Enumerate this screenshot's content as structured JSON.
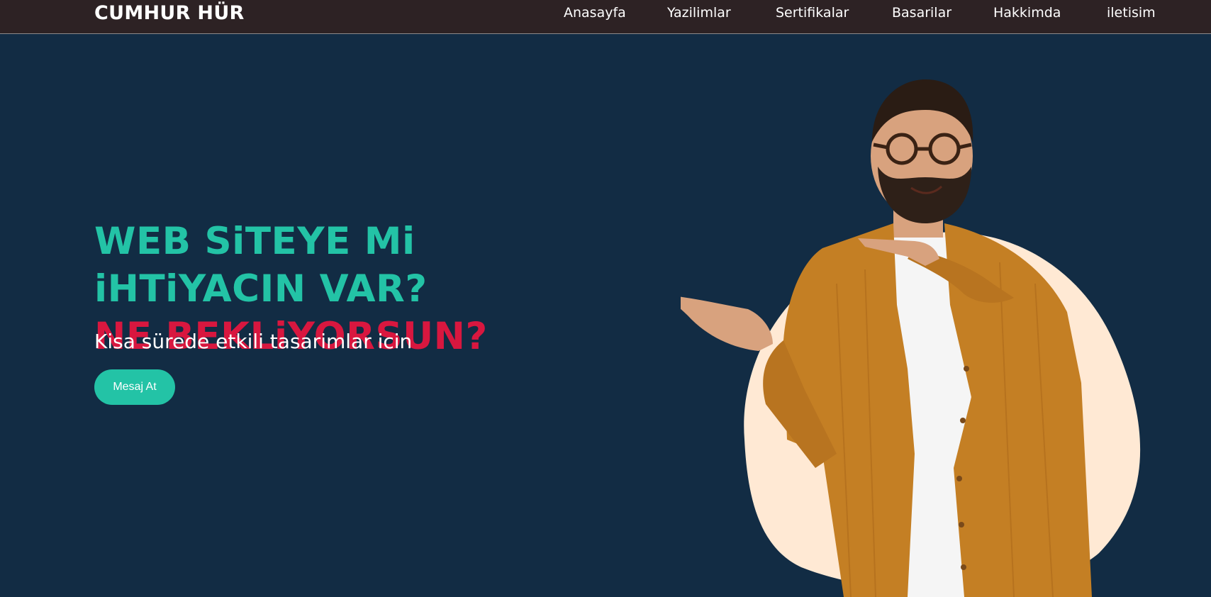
{
  "header": {
    "brand": "CUMHUR HÜR",
    "nav": [
      {
        "label": "Anasayfa"
      },
      {
        "label": "Yazilimlar"
      },
      {
        "label": "Sertifikalar"
      },
      {
        "label": "Basarilar"
      },
      {
        "label": "Hakkimda"
      },
      {
        "label": "iletisim"
      }
    ]
  },
  "hero": {
    "headline_line1": "WEB SiTEYE Mi",
    "headline_line2": "iHTiYACIN VAR?",
    "headline_line3": "NE BEKLiYORSUN?",
    "subtitle": "Kisa sürede etkili tasarimlar icin",
    "cta_label": "Mesaj At"
  },
  "colors": {
    "background": "#122c44",
    "navbar": "#2d2224",
    "accent_teal": "#23c3a6",
    "accent_red": "#d8173f",
    "blob": "#ffe9d4"
  }
}
